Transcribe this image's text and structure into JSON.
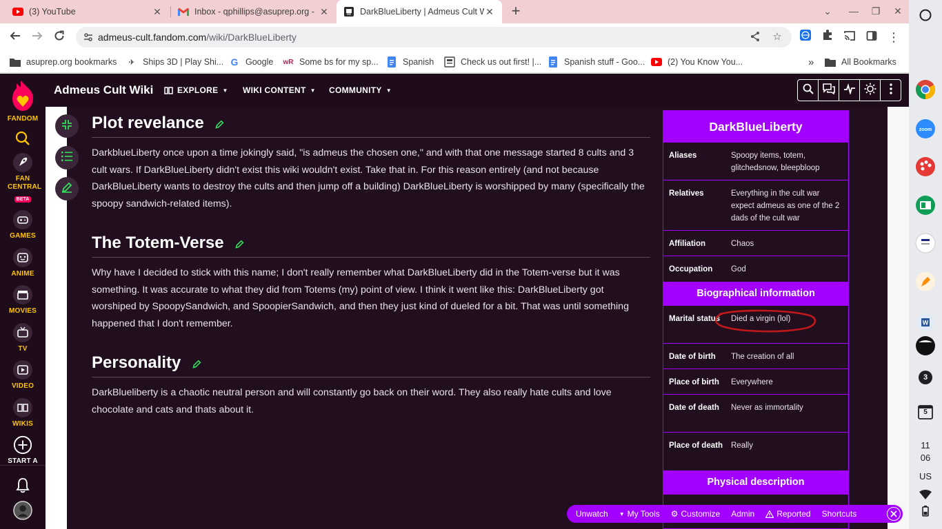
{
  "browser": {
    "tabs": [
      {
        "title": "(3) YouTube",
        "icon": "youtube-icon",
        "active": false
      },
      {
        "title": "Inbox - qphillips@asuprep.org -",
        "icon": "gmail-icon",
        "active": false
      },
      {
        "title": "DarkBlueLiberty | Admeus Cult W",
        "icon": "fandom-tab-icon",
        "active": true
      }
    ],
    "url_host": "admeus-cult.fandom.com",
    "url_path": "/wiki/DarkBlueLiberty",
    "bookmarks": [
      {
        "label": "asuprep.org bookmarks",
        "icon": "folder-icon"
      },
      {
        "label": "Ships 3D | Play Shi...",
        "icon": "ship-icon"
      },
      {
        "label": "Google",
        "icon": "google-icon"
      },
      {
        "label": "Some bs for my sp...",
        "icon": "wr-icon"
      },
      {
        "label": "Spanish",
        "icon": "docs-icon"
      },
      {
        "label": "Check us out first! |...",
        "icon": "page-icon"
      },
      {
        "label": "Spanish stuff - Goo...",
        "icon": "docs-icon"
      },
      {
        "label": "(2) You Know You...",
        "icon": "youtube-icon"
      }
    ],
    "all_bookmarks": "All Bookmarks",
    "more_bookmarks": "»"
  },
  "fandom_rail": {
    "items": [
      {
        "label": "FANDOM",
        "icon": "fandom-heart-icon"
      },
      {
        "label": "",
        "icon": "search-icon"
      },
      {
        "label": "FAN CENTRAL",
        "icon": "rocket-icon",
        "badge": "BETA"
      },
      {
        "label": "GAMES",
        "icon": "gamepad-icon"
      },
      {
        "label": "ANIME",
        "icon": "anime-icon"
      },
      {
        "label": "MOVIES",
        "icon": "clapper-icon"
      },
      {
        "label": "TV",
        "icon": "tv-icon"
      },
      {
        "label": "VIDEO",
        "icon": "video-play-icon"
      },
      {
        "label": "WIKIS",
        "icon": "book-icon"
      },
      {
        "label": "START A",
        "icon": "plus-circle-icon"
      }
    ]
  },
  "wiki_header": {
    "name": "Admeus Cult Wiki",
    "nav": [
      {
        "label": "EXPLORE"
      },
      {
        "label": "WIKI CONTENT"
      },
      {
        "label": "COMMUNITY"
      }
    ]
  },
  "article": {
    "sections": [
      {
        "heading": "Plot revelance",
        "paragraph": "DarkblueLiberty once upon a time jokingly said, \"is admeus the chosen one,\" and with that one message started 8 cults and 3 cult wars. If DarkBlueLiberty didn't exist this wiki wouldn't exist. Take that in. For this reason entirely (and not because DarkBlueLiberty wants to destroy the cults and then jump off a building) DarkBlueLiberty is worshipped by many (specifically the spoopy sandwich-related items)."
      },
      {
        "heading": "The Totem-Verse",
        "paragraph": "Why have I decided to stick with this name; I don't really remember what DarkBlueLiberty did in the Totem-verse but it was something. It was accurate to what they did from Totems (my) point of view. I think it went like this: DarkBlueLiberty got worshiped by SpoopySandwich, and SpoopierSandwich, and then they just kind of dueled for a bit. That was until something happened that I don't remember."
      },
      {
        "heading": "Personality",
        "paragraph": "DarkBlueliberty is a chaotic neutral person and will constantly go back on their word. They also really hate cults and love chocolate and cats and thats about it."
      }
    ]
  },
  "infobox": {
    "title": "DarkBlueLiberty",
    "rows_top": [
      {
        "label": "Aliases",
        "value": "Spoopy items, totem, glitchedsnow, bleepbloop"
      },
      {
        "label": "Relatives",
        "value": "Everything in the cult war expect admeus as one of the 2 dads of the cult war"
      },
      {
        "label": "Affiliation",
        "value": "Chaos"
      },
      {
        "label": "Occupation",
        "value": "God"
      }
    ],
    "section_bio": "Biographical information",
    "rows_bio": [
      {
        "label": "Marital status",
        "value": "Died a virgin (lol)"
      },
      {
        "label": "Date of birth",
        "value": "The creation of all"
      },
      {
        "label": "Place of birth",
        "value": "Everywhere"
      },
      {
        "label": "Date of death",
        "value": "Never as immortality"
      },
      {
        "label": "Place of death",
        "value": "Really"
      }
    ],
    "section_phys": "Physical description",
    "annotation_color": "#c0181b"
  },
  "bottom_toolbar": {
    "items": [
      {
        "label": "Unwatch",
        "icon": ""
      },
      {
        "label": "My Tools",
        "icon": "caret-down-icon"
      },
      {
        "label": "Customize",
        "icon": "gear-icon"
      },
      {
        "label": "Admin",
        "icon": ""
      },
      {
        "label": "Reported",
        "icon": "warning-icon"
      },
      {
        "label": "Shortcuts",
        "icon": ""
      }
    ]
  },
  "shelf": {
    "notification_count": "3",
    "calendar_day": "5",
    "clock_hour": "11",
    "clock_min": "06",
    "locale": "US"
  },
  "colors": {
    "fandom_dark": "#1e0c1b",
    "accent_purple": "#a200ff",
    "fandom_yellow": "#ffc500",
    "fandom_pink": "#fa005a",
    "edit_green": "#32e05b"
  }
}
